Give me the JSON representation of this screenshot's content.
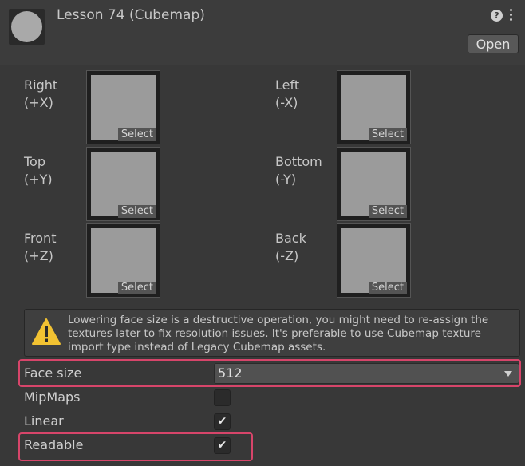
{
  "header": {
    "title": "Lesson 74 (Cubemap)",
    "open_label": "Open",
    "help_glyph": "?"
  },
  "faces": [
    {
      "label": "Right\n(+X)",
      "select": "Select"
    },
    {
      "label": "Left\n(-X)",
      "select": "Select"
    },
    {
      "label": "Top\n(+Y)",
      "select": "Select"
    },
    {
      "label": "Bottom\n(-Y)",
      "select": "Select"
    },
    {
      "label": "Front\n(+Z)",
      "select": "Select"
    },
    {
      "label": "Back\n(-Z)",
      "select": "Select"
    }
  ],
  "warning": {
    "text": "Lowering face size is a destructive operation, you might need to re-assign the textures later to fix resolution issues. It's preferable to use Cubemap texture import type instead of Legacy Cubemap assets."
  },
  "properties": {
    "face_size": {
      "label": "Face size",
      "value": "512"
    },
    "mipmaps": {
      "label": "MipMaps",
      "checked": false
    },
    "linear": {
      "label": "Linear",
      "checked": true
    },
    "readable": {
      "label": "Readable",
      "checked": true
    }
  },
  "check_glyph": "✔",
  "colors": {
    "background": "#383838",
    "highlight": "#d7456a",
    "warning_yellow": "#f2c232"
  }
}
